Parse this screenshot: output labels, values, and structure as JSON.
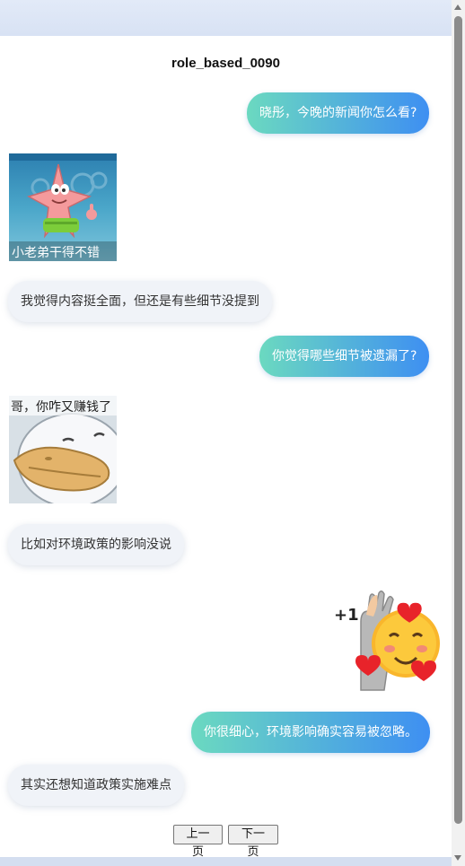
{
  "conversation": {
    "title": "role_based_0090"
  },
  "messages": [
    {
      "side": "right",
      "text": "晓彤，今晚的新闻你怎么看?"
    },
    {
      "side": "left",
      "sticker": "patrick-thumbs-up",
      "caption": "小老弟干得不错"
    },
    {
      "side": "left",
      "text": "我觉得内容挺全面，但还是有些细节没提到"
    },
    {
      "side": "right",
      "text": "你觉得哪些细节被遗漏了?"
    },
    {
      "side": "left",
      "sticker": "white-duck",
      "caption": "哥，你咋又赚钱了"
    },
    {
      "side": "left",
      "text": "比如对环境政策的影响没说"
    },
    {
      "side": "right",
      "sticker": "smiling-face-plus-one",
      "caption": "+1"
    },
    {
      "side": "right",
      "text": "你很细心，环境影响确实容易被忽略。"
    },
    {
      "side": "left",
      "text": "其实还想知道政策实施难点"
    }
  ],
  "pager": {
    "prev_label": "上一页",
    "next_label": "下一页"
  },
  "colors": {
    "right_bubble_start": "#6bd9c0",
    "right_bubble_end": "#3e8ff2",
    "left_bubble": "#f0f3f8"
  }
}
